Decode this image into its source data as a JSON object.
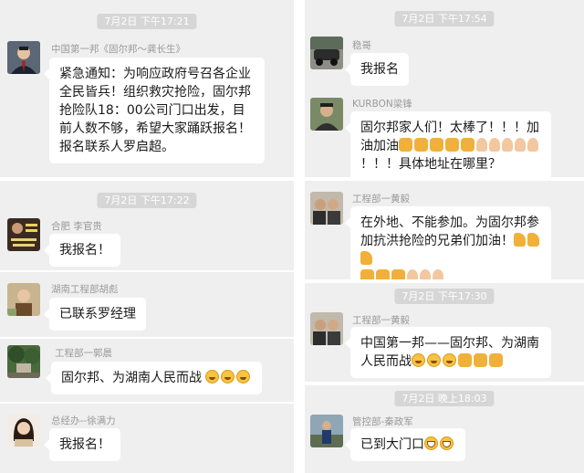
{
  "left": {
    "panels": [
      {
        "timestamp": "7月2日 下午17:21",
        "messages": [
          {
            "sender": "中国第一邦《固尔邦～龚长生》",
            "avatar": "man-suit-avatar",
            "text": "紧急通知：为响应政府号召各企业全民皆兵！组织救灾抢险，固尔邦抢险队18：00公司门口出发，目前人数不够，希望大家踊跃报名！报名联系人罗启超。"
          }
        ]
      },
      {
        "timestamp": "7月2日 下午17:22",
        "messages": [
          {
            "sender": "合肥 李官贵",
            "avatar": "poster-avatar",
            "text": "我报名！"
          },
          {
            "sender": "湖南工程部胡彪",
            "avatar": "child-avatar",
            "text": "已联系罗经理"
          },
          {
            "sender": "工程部一郭晨",
            "avatar": "garden-avatar",
            "text": "固尔邦、为湖南人民而战",
            "emoji": [
              "face",
              "face",
              "face"
            ]
          },
          {
            "sender": "总经办--徐满力",
            "avatar": "woman-avatar",
            "text": "我报名！"
          }
        ]
      }
    ]
  },
  "right": {
    "panels": [
      {
        "timestamp": "7月2日 下午17:54",
        "messages": [
          {
            "sender": "稳哥",
            "avatar": "car-avatar",
            "text": "我报名"
          },
          {
            "sender": "KURBON梁锋",
            "avatar": "portrait-avatar",
            "text_a": "固尔邦家人们！太棒了！！！加油加油",
            "emoji_a": [
              "fist",
              "fist",
              "fist",
              "fist",
              "fist",
              "pray",
              "pray",
              "pray",
              "pray"
            ],
            "emoji_b": [
              "pray"
            ],
            "text_b": "！！！具体地址在哪里？"
          },
          {
            "sender": "工程部一黄毅",
            "avatar": "group-avatar",
            "text_a": "在外地、不能参加。为固尔邦参加抗洪抢险的兄弟们加油！",
            "emoji_a": [
              "thumb",
              "thumb",
              "thumb"
            ],
            "emoji_b": [
              "fist",
              "fist",
              "fist",
              "pray",
              "pray",
              "pray"
            ]
          }
        ]
      },
      {
        "timestamp": "7月2日 下午17:30",
        "messages": [
          {
            "sender": "工程部一黄毅",
            "avatar": "group-avatar",
            "text": "中国第一邦——固尔邦、为湖南人民而战",
            "emoji": [
              "face",
              "face",
              "face",
              "fist",
              "fist",
              "fist"
            ]
          }
        ]
      },
      {
        "timestamp": "7月2日 晚上18:03",
        "messages": [
          {
            "sender": "管控部-秦政军",
            "avatar": "outdoor-avatar",
            "text": "已到大门口",
            "emoji": [
              "grin",
              "grin"
            ]
          }
        ]
      }
    ]
  },
  "colors": {
    "background": "#efefef",
    "bubble": "#ffffff",
    "timestamp_bg": "#d6d6d6",
    "name": "#9a9a9a"
  }
}
